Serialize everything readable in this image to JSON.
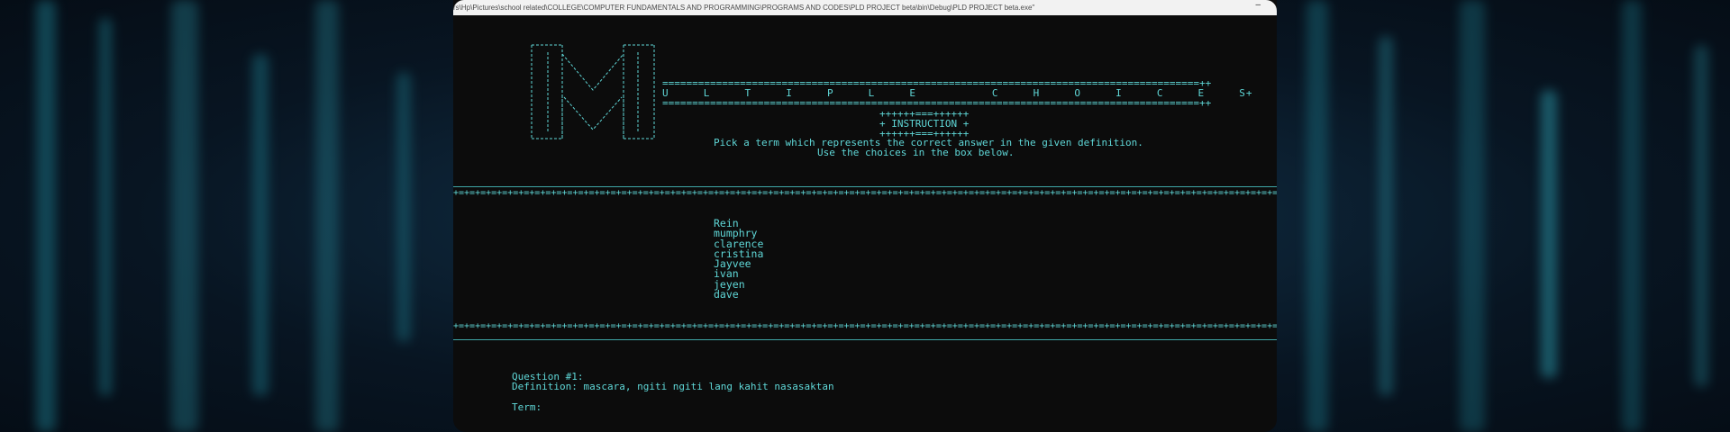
{
  "window": {
    "title": "rs\\Hp\\Pictures\\school related\\COLLEGE\\COMPUTER FUNDAMENTALS AND PROGRAMMING\\PROGRAMS AND CODES\\PLD PROJECT beta\\bin\\Debug\\PLD PROJECT beta.exe\"",
    "minimize_glyph": "–"
  },
  "banner": {
    "top_rule": "==========================================================================================++",
    "word_line": "U     L     T     I     P     L     E           C     H     O     I     C     E     S+",
    "bottom_rule": "==========================================================================================++"
  },
  "instruction": {
    "top": "++++++===++++++",
    "label": "+ INSTRUCTION +",
    "bottom": "++++++===++++++",
    "line1": "Pick a term which represents the correct answer in the given definition.",
    "line2": "Use the choices in the box below."
  },
  "separator_pattern": "+=+=+=+=+=+=+=+=+=+=+=+=+=+=+=+=+=+=+=+=+=+=+=+=+=+=+=+=+=+=+=+=+=+=+=+=+=+=+=+=+=+=+=+=+=+=+=+=+=+=+=+=+=+=+=+=+=+=+=+=+=+=+=+=+=+=+=+=+=+=+=+=+=+=+=+=+=+",
  "choices": [
    "Rein",
    "mumphry",
    "clarence",
    "cristina",
    "Jayvee",
    "ivan",
    "jeyen",
    "dave"
  ],
  "question": {
    "header": "Question #1:",
    "definition": "Definition: mascara, ngiti ngiti lang kahit nasasaktan",
    "prompt": "Term:"
  },
  "colors": {
    "console_text": "#5fd7d7",
    "console_bg": "#0c0c0c"
  }
}
